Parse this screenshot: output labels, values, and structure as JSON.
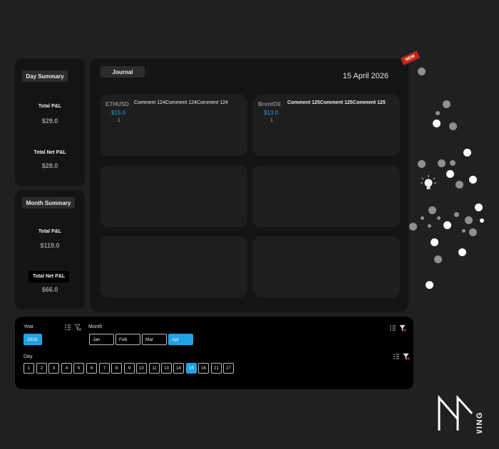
{
  "day_summary": {
    "title": "Day Summary",
    "total_pl_label": "Total P&L",
    "total_pl_value": "$29.0",
    "total_net_pl_label": "Total Net P&L",
    "total_net_pl_value": "$28.0"
  },
  "month_summary": {
    "title": "Month Summary",
    "total_pl_label": "Total P&L",
    "total_pl_value": "$119.0",
    "total_net_pl_label": "Total Net P&L",
    "total_net_pl_value": "$66.0"
  },
  "journal": {
    "button_label": "Journal",
    "date": "15 April 2026",
    "new_badge": "NEW",
    "cards": [
      {
        "symbol": "ETHUSD",
        "amount": "$15.0",
        "count": "1",
        "comment": "Comment 124Comment 124Comment 124"
      },
      {
        "symbol": "BrentOil",
        "amount": "$13.0",
        "count": "1",
        "comment": "Comment 125Comment 125Comment 125"
      },
      {},
      {},
      {},
      {}
    ]
  },
  "filters": {
    "year_title": "Year",
    "years": [
      "2026"
    ],
    "selected_year": "2026",
    "month_title": "Month",
    "months": [
      "Jan",
      "Feb",
      "Mar",
      "Apr"
    ],
    "selected_month": "Apr",
    "day_title": "Day",
    "days": [
      "1",
      "2",
      "3",
      "4",
      "5",
      "6",
      "7",
      "8",
      "9",
      "10",
      "11",
      "13",
      "14",
      "15",
      "16",
      "21",
      "27"
    ],
    "selected_day": "15"
  },
  "brand": {
    "logo_text": "SWING",
    "accent_color": "#1fa3e6",
    "count_color": "#e5b200",
    "badge_color": "#c0281e"
  }
}
